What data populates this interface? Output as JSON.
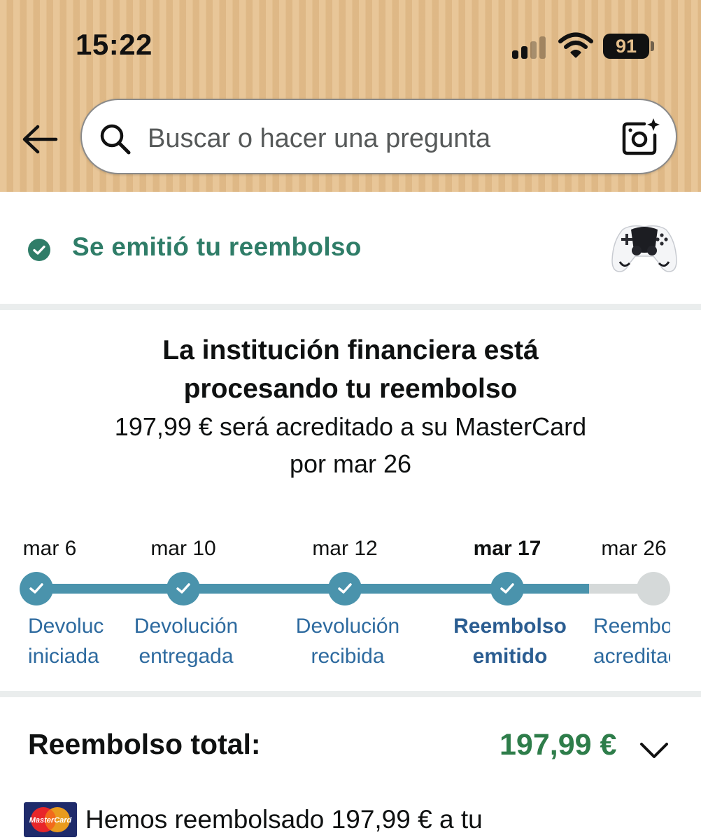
{
  "status_bar": {
    "time": "15:22",
    "battery": "91"
  },
  "search": {
    "placeholder": "Buscar o hacer una pregunta"
  },
  "icons": {
    "back": "back-arrow-icon",
    "search": "search-icon",
    "camera": "camera-sparkle-icon",
    "status_check": "check-circle-icon",
    "chevron": "chevron-down-icon"
  },
  "status": {
    "text": "Se emitió tu reembolso",
    "color": "#2f7d68"
  },
  "info": {
    "title_line1": "La institución financiera está",
    "title_line2": "procesando tu reembolso",
    "sub_line1": "197,99 € será acreditado a su MasterCard",
    "sub_line2": "por mar 26"
  },
  "tracker": {
    "completed_color": "#4a93ac",
    "pending_color": "#d5d9d9",
    "steps": [
      {
        "date": "mar 6",
        "label_line1": "Devolución",
        "label_line2": "iniciada",
        "done": true,
        "current": false
      },
      {
        "date": "mar 10",
        "label_line1": "Devolución",
        "label_line2": "entregada",
        "done": true,
        "current": false
      },
      {
        "date": "mar 12",
        "label_line1": "Devolución",
        "label_line2": "recibida",
        "done": true,
        "current": false
      },
      {
        "date": "mar 17",
        "label_line1": "Reembolso",
        "label_line2": "emitido",
        "done": true,
        "current": true
      },
      {
        "date": "mar 26",
        "label_line1": "Reembolso",
        "label_line2": "acreditado",
        "done": false,
        "current": false
      }
    ]
  },
  "total": {
    "label": "Reembolso total:",
    "value": "197,99 €",
    "value_color": "#2e7d4a"
  },
  "refund_detail": {
    "card_logo_text": "MasterCard",
    "text": "Hemos reembolsado 197,99 € a tu"
  }
}
